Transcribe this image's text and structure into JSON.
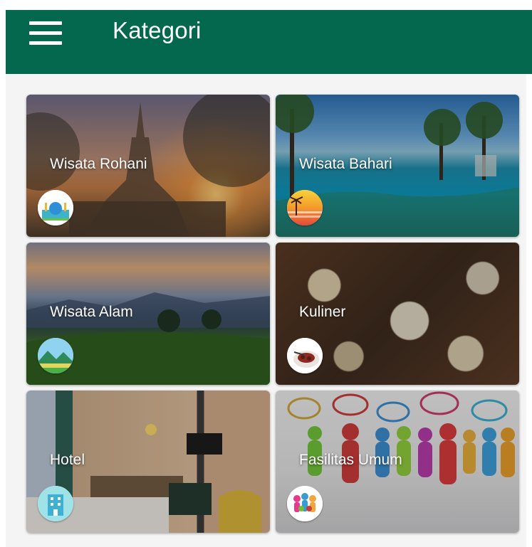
{
  "appbar": {
    "title": "Kategori",
    "menu_icon": "hamburger-menu-icon",
    "background": "#04684f"
  },
  "categories": [
    {
      "label": "Wisata Rohani",
      "icon": "mosque-icon"
    },
    {
      "label": "Wisata Bahari",
      "icon": "sunset-beach-icon"
    },
    {
      "label": "Wisata Alam",
      "icon": "mountain-landscape-icon"
    },
    {
      "label": "Kuliner",
      "icon": "food-plate-icon"
    },
    {
      "label": "Hotel",
      "icon": "hotel-building-icon"
    },
    {
      "label": "Fasilitas Umum",
      "icon": "people-group-icon"
    }
  ]
}
